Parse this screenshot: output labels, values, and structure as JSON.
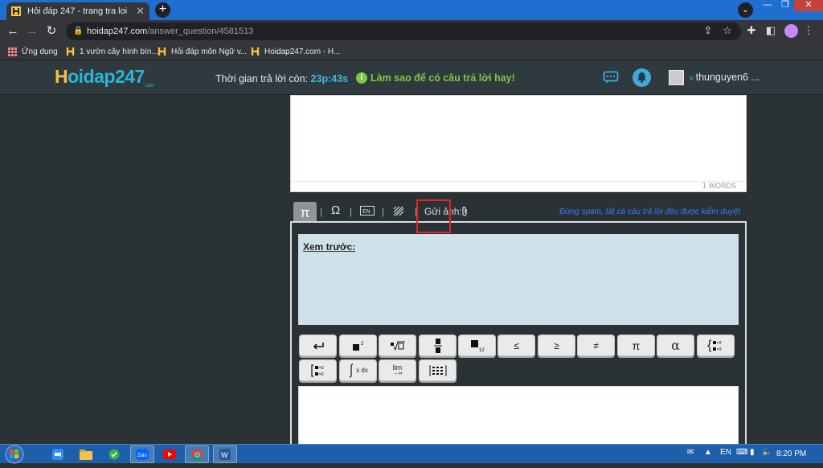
{
  "browser": {
    "tab_title": "Hỏi đáp 247 - trang tra loi",
    "url_host": "hoidap247.com",
    "url_path": "/answer_question/4581513",
    "bookmarks": [
      "Ứng dụng",
      "1 vườn cây hình bìn...",
      "Hỏi đáp môn Ngữ v...",
      "Hoidap247.com - H..."
    ]
  },
  "site": {
    "logo": "oidap247",
    "logo_h": "H",
    "logo_com": ".com",
    "timer_label": "Thời gian trả lời còn:",
    "timer_value": "23p:43s",
    "tip": "Làm sao để có câu trả lời hay!",
    "username": "thunguyen6 ..."
  },
  "editor": {
    "word_count": "1 WORDS",
    "upload_label": "Gửi ảnh:",
    "spam_notice": "Đừng spam, tất cả câu trả lời đều được kiểm duyệt",
    "preview_label": "Xem trước:",
    "math_buttons": {
      "le": "≤",
      "ge": "≥",
      "ne": "≠",
      "pi": "π",
      "alpha": "α",
      "lim": "lim",
      "lim_sub": "→∞",
      "integral": "x dx"
    }
  },
  "taskbar": {
    "language": "EN",
    "time": "8:20 PM"
  },
  "colors": {
    "brand_blue": "#29b6d8",
    "brand_yellow": "#f5c242",
    "tip_green": "#7ec83f",
    "highlight_red": "#e0252b"
  }
}
